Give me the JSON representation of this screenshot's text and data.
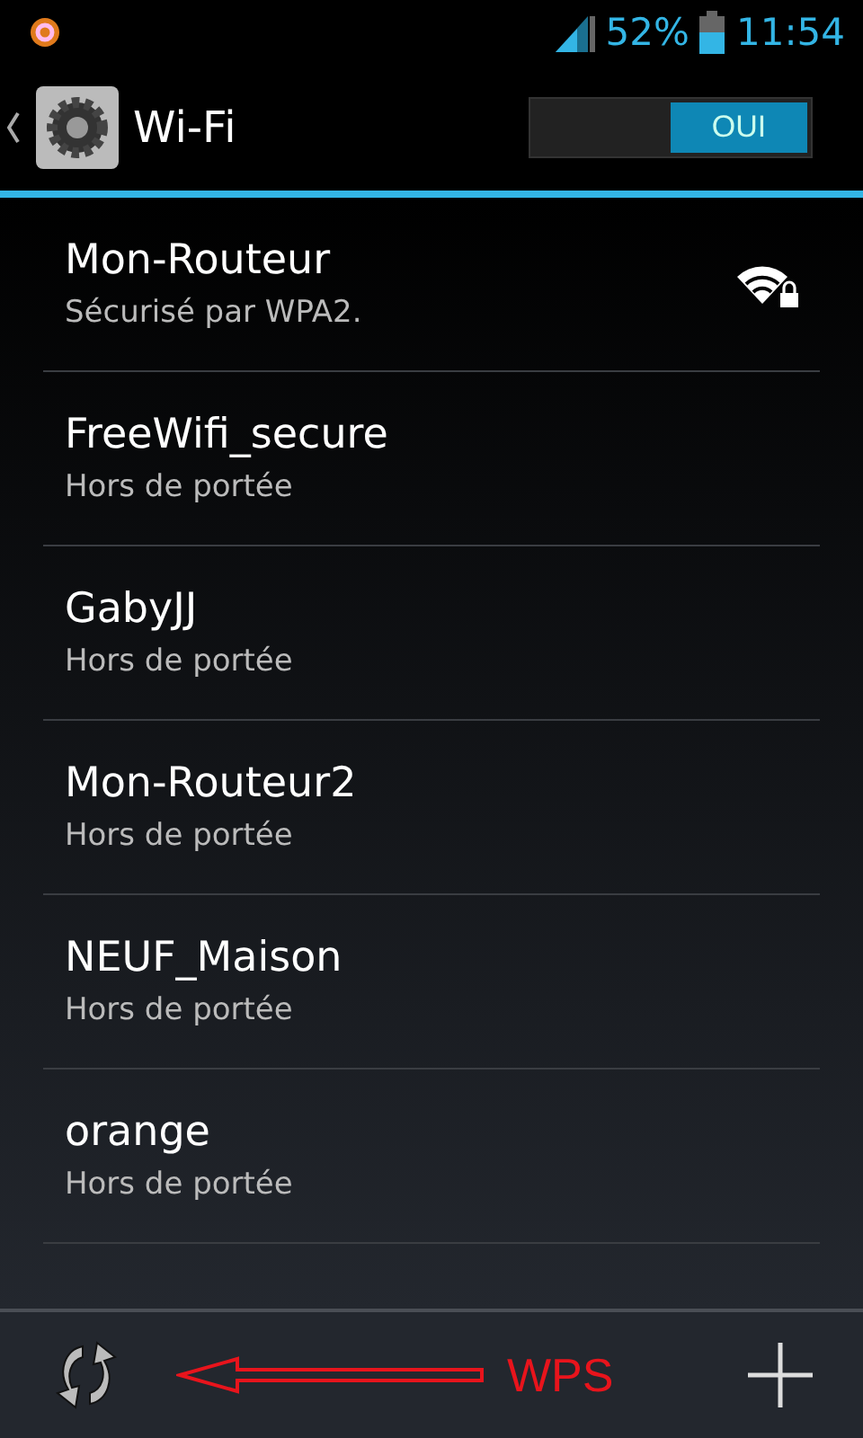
{
  "status_bar": {
    "battery": "52%",
    "time": "11:54"
  },
  "header": {
    "title": "Wi-Fi",
    "toggle": {
      "label": "OUI",
      "on": true
    }
  },
  "networks": [
    {
      "name": "Mon-Routeur",
      "status": "Sécurisé par WPA2.",
      "in_range": true
    },
    {
      "name": "FreeWifi_secure",
      "status": "Hors de portée",
      "in_range": false
    },
    {
      "name": "GabyJJ",
      "status": "Hors de portée",
      "in_range": false
    },
    {
      "name": "Mon-Routeur2",
      "status": "Hors de portée",
      "in_range": false
    },
    {
      "name": "NEUF_Maison",
      "status": "Hors de portée",
      "in_range": false
    },
    {
      "name": "orange",
      "status": "Hors de portée",
      "in_range": false
    }
  ],
  "bottom_bar": {
    "annotation": "WPS"
  }
}
